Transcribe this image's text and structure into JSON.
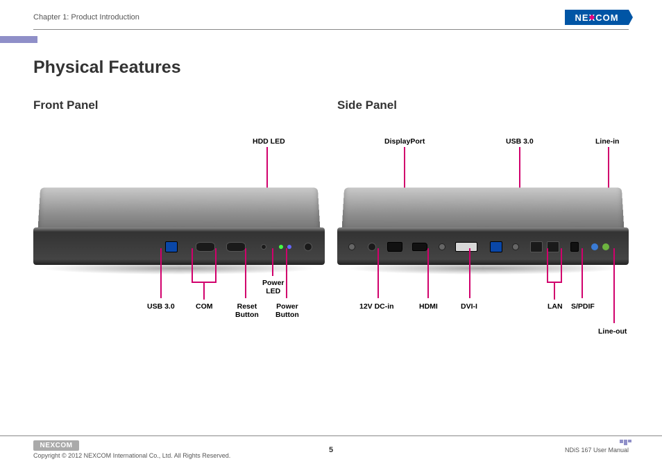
{
  "header": {
    "chapter": "Chapter 1: Product Introduction",
    "brand": "NE COM"
  },
  "title": "Physical Features",
  "front_panel": {
    "heading": "Front Panel",
    "labels_top": {
      "hdd_led": "HDD LED"
    },
    "labels_bottom": {
      "usb30": "USB 3.0",
      "com": "COM",
      "reset": "Reset\nButton",
      "power_led": "Power\nLED",
      "power_btn": "Power\nButton"
    }
  },
  "side_panel": {
    "heading": "Side Panel",
    "labels_top": {
      "displayport": "DisplayPort",
      "usb30": "USB 3.0",
      "linein": "Line-in"
    },
    "labels_bottom": {
      "dcin": "12V DC-in",
      "hdmi": "HDMI",
      "dvii": "DVI-I",
      "lan": "LAN",
      "spdif": "S/PDIF",
      "lineout": "Line-out"
    }
  },
  "footer": {
    "brand": "NE COM",
    "copyright": "Copyright © 2012 NEXCOM International Co., Ltd. All Rights Reserved.",
    "page": "5",
    "doc": "NDiS 167 User Manual"
  }
}
